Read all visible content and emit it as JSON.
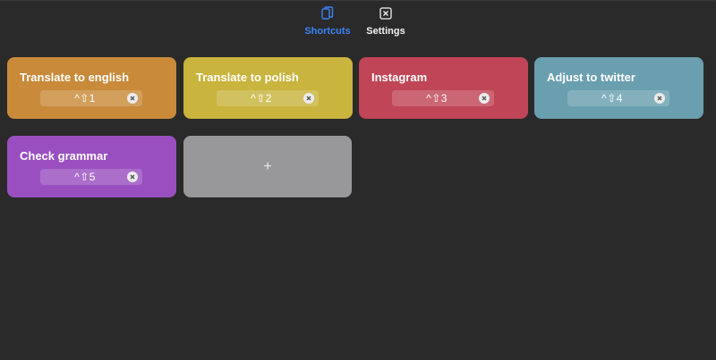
{
  "tabs": [
    {
      "label": "Shortcuts",
      "icon": "clipboard-copy-icon",
      "active": true
    },
    {
      "label": "Settings",
      "icon": "x-box-icon",
      "active": false
    }
  ],
  "shortcuts": [
    {
      "title": "Translate to english",
      "keys": "^⇧1",
      "color": "#c98a3a"
    },
    {
      "title": "Translate to polish",
      "keys": "^⇧2",
      "color": "#c9b43d"
    },
    {
      "title": "Instagram",
      "keys": "^⇧3",
      "color": "#c04556"
    },
    {
      "title": "Adjust to twitter",
      "keys": "^⇧4",
      "color": "#6a9fb0"
    },
    {
      "title": "Check grammar",
      "keys": "^⇧5",
      "color": "#9a4fc0"
    }
  ],
  "add_button": {
    "label": "+"
  },
  "colors": {
    "background": "#2a2a2a",
    "accent": "#3b82f6",
    "add_card": "#98979a"
  }
}
